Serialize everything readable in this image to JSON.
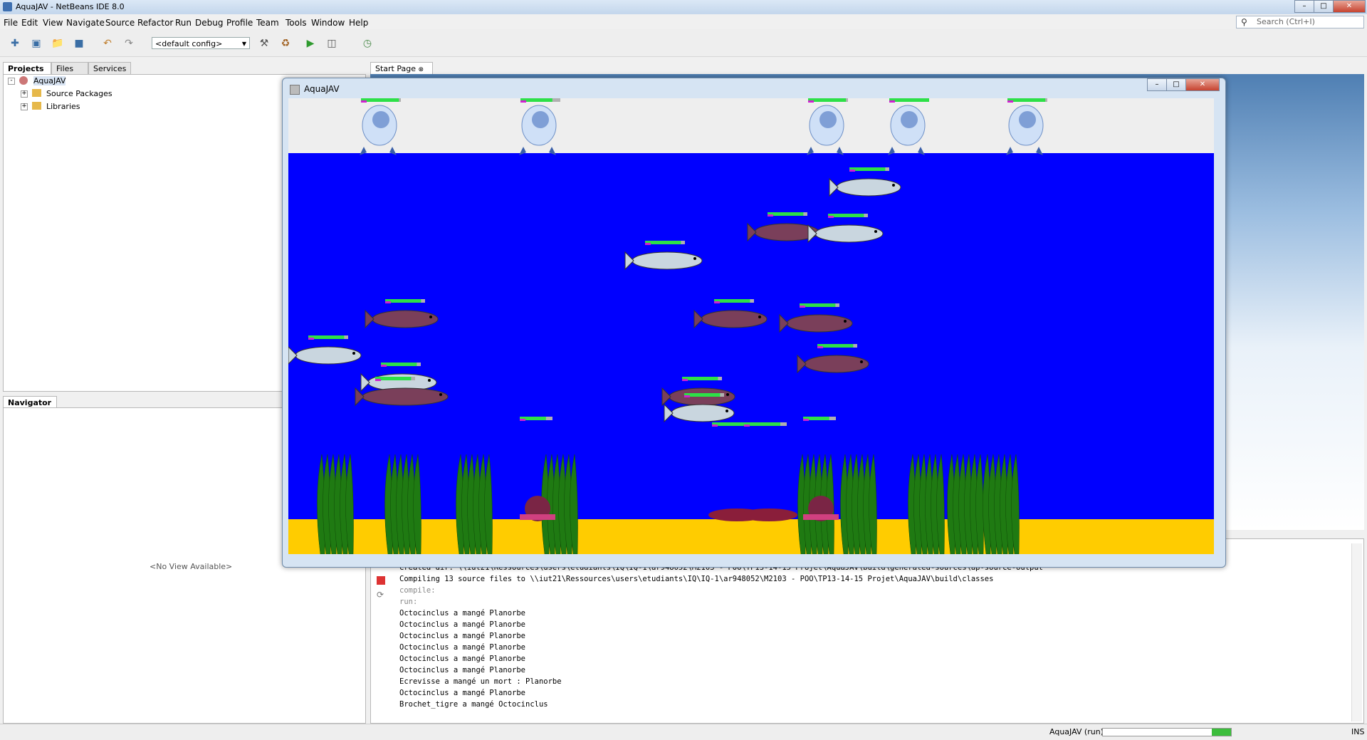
{
  "window": {
    "title": "AquaJAV - NetBeans IDE 8.0",
    "min": "–",
    "max": "□",
    "close": "✕"
  },
  "menu": [
    "File",
    "Edit",
    "View",
    "Navigate",
    "Source",
    "Refactor",
    "Run",
    "Debug",
    "Profile",
    "Team",
    "Tools",
    "Window",
    "Help"
  ],
  "toolbar": {
    "config": "<default config>"
  },
  "search": {
    "placeholder": "Search (Ctrl+I)"
  },
  "projects_panel": {
    "tabs": [
      "Projects",
      "Files",
      "Services"
    ],
    "tree": {
      "root": "AquaJAV",
      "children": [
        "Source Packages",
        "Libraries"
      ]
    }
  },
  "navigator": {
    "tab": "Navigator",
    "empty_text": "<No View Available>"
  },
  "editor": {
    "tab": "Start Page"
  },
  "app_window": {
    "title": "AquaJAV"
  },
  "output": {
    "lines": [
      "Created dir: \\\\iut21\\Ressources\\users\\etudiants\\IQ\\IQ-1\\ar948052\\M2103 - POO\\TP13-14-15 Projet\\AquaJAV\\build\\generated-sources\\ap-source-output",
      "Compiling 13 source files to \\\\iut21\\Ressources\\users\\etudiants\\IQ\\IQ-1\\ar948052\\M2103 - POO\\TP13-14-15 Projet\\AquaJAV\\build\\classes",
      "compile:",
      "run:",
      "Octocinclus a mangé Planorbe",
      "Octocinclus a mangé Planorbe",
      "Octocinclus a mangé Planorbe",
      "Octocinclus a mangé Planorbe",
      "Octocinclus a mangé Planorbe",
      "Octocinclus a mangé Planorbe",
      "Ecrevisse a mangé un mort : Planorbe",
      "Octocinclus a mangé Planorbe",
      "Brochet_tigre a mangé Octocinclus"
    ]
  },
  "status": {
    "run": "AquaJAV (run)",
    "mode": "INS",
    "progress": 0.15
  },
  "colors": {
    "water": "#0000ff",
    "sand": "#ffcc00",
    "sky": "#eeeeee",
    "health": "#2de047",
    "weed": "#1f7a12"
  },
  "scene": {
    "birds": [
      {
        "health": 0.95
      },
      {
        "health": 0.8
      },
      {
        "health": 0.95
      },
      {
        "health": 1.0
      },
      {
        "health": 0.95
      }
    ],
    "fish_kinds": [
      "pike",
      "catfish"
    ],
    "weeds": 9,
    "snails": 2,
    "crayfish": 2
  }
}
